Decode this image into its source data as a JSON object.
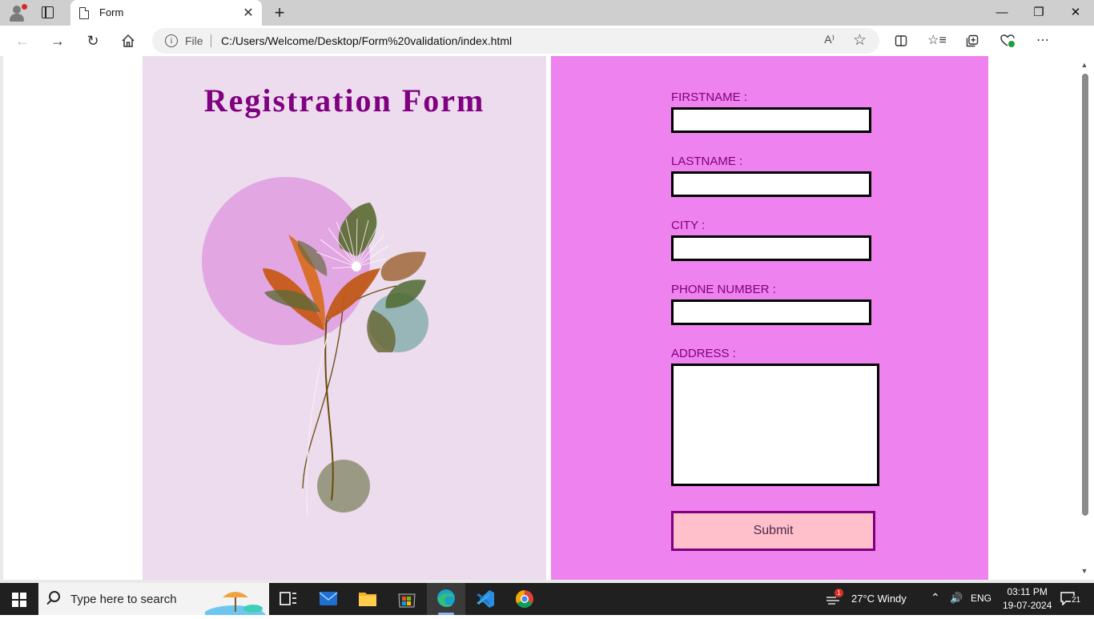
{
  "browser": {
    "tab_title": "Form",
    "tab_close": "✕",
    "new_tab": "+",
    "window_controls": {
      "minimize": "—",
      "restore": "❐",
      "close": "✕"
    },
    "address": {
      "scheme_label": "File",
      "url": "C:/Users/Welcome/Desktop/Form%20validation/index.html",
      "read_aloud": "A⁾"
    }
  },
  "page": {
    "title": "Registration Form",
    "fields": [
      {
        "label": "FIRSTNAME :",
        "value": ""
      },
      {
        "label": "LASTNAME :",
        "value": ""
      },
      {
        "label": "CITY :",
        "value": ""
      },
      {
        "label": "PHONE NUMBER :",
        "value": ""
      }
    ],
    "address_label": "ADDRESS :",
    "submit_label": "Submit",
    "colors": {
      "left_bg": "#ecdcee",
      "right_bg": "#ee82ee",
      "title": "#800080",
      "label": "#800080",
      "button_bg": "#ffc0cb",
      "button_border": "#800080"
    }
  },
  "taskbar": {
    "search_placeholder": "Type here to search",
    "weather": "27°C  Windy",
    "language": "ENG",
    "time": "03:11 PM",
    "date": "19-07-2024",
    "notification_count": "21",
    "weather_badge": "1"
  }
}
